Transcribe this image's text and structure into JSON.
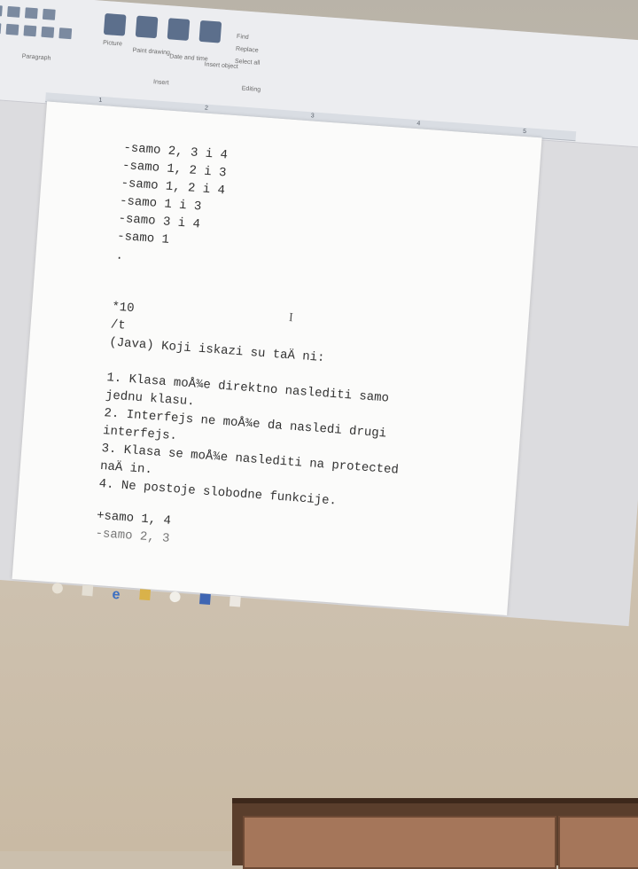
{
  "ribbon": {
    "group_paragraph": "Paragraph",
    "group_insert": "Insert",
    "group_editing": "Editing",
    "btn_picture": "Picture",
    "btn_paint_drawing": "Paint drawing",
    "btn_date_time": "Date and time",
    "btn_insert_object": "Insert object",
    "btn_find": "Find",
    "btn_replace": "Replace",
    "btn_select_all": "Select all"
  },
  "ruler": {
    "marks": [
      "1",
      "2",
      "3",
      "4",
      "5"
    ]
  },
  "document": {
    "answer_options_top": [
      "-samo 2, 3 i 4",
      "-samo 1, 2 i 3",
      "-samo 1, 2 i 4",
      "-samo 1 i 3",
      "-samo 3 i 4",
      "-samo 1"
    ],
    "bullet": ".",
    "question_number": "*10",
    "question_type": "/t",
    "question_text": "(Java) Koji iskazi su taÄ ni:",
    "statements": [
      "1. Klasa moÅ¾e direktno naslediti samo",
      "jednu klasu.",
      "2. Interfejs ne moÅ¾e da nasledi drugi",
      "interfejs.",
      "3. Klasa se moÅ¾e naslediti na protected",
      "naÄ in.",
      "4. Ne postoje slobodne funkcije."
    ],
    "answer_correct": "+samo 1, 4",
    "answer_next_partial": "-samo 2, 3"
  },
  "colors": {
    "wall": "#cfc4b4",
    "screen": "#dcdcdf",
    "page": "#fbfbfa",
    "text": "#333333",
    "cabinet": "#5a3e2c"
  },
  "taskbar": {
    "icons": [
      "edge-browser-icon",
      "file-explorer-icon",
      "chrome-icon",
      "wordpad-icon",
      "app-icon"
    ]
  }
}
